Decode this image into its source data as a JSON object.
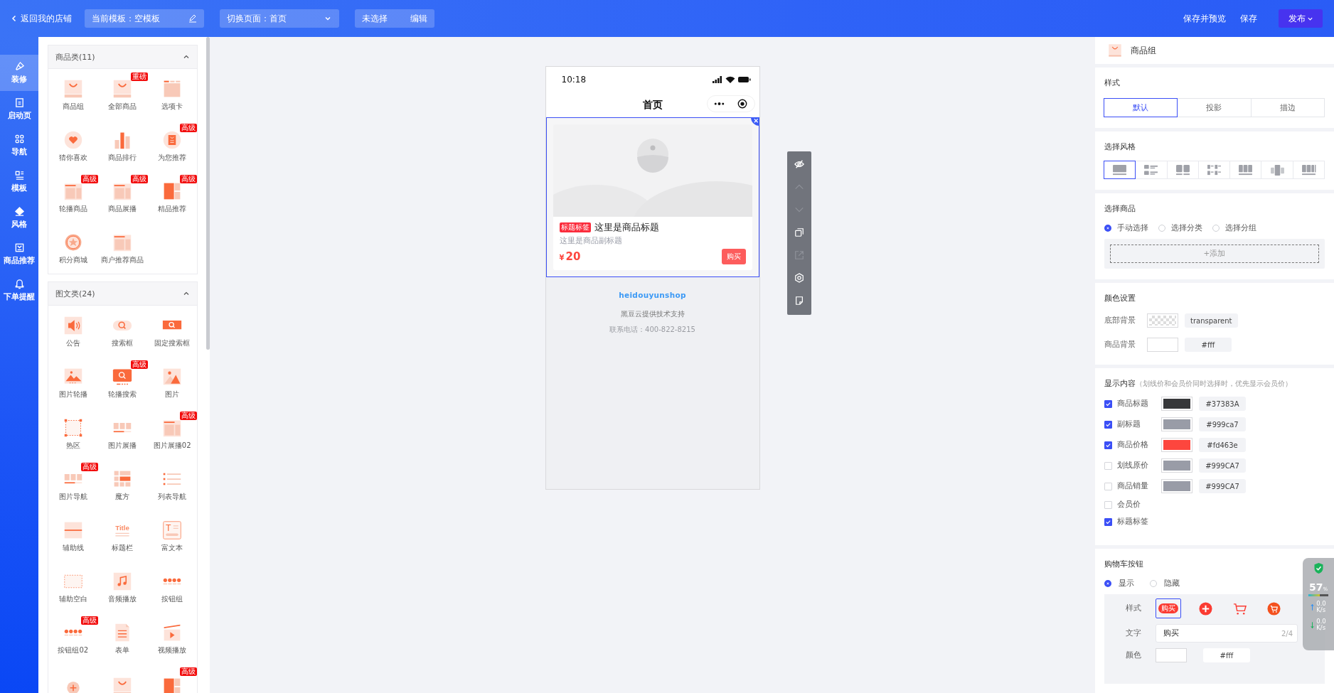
{
  "topbar": {
    "back": "返回我的店铺",
    "template": "当前模板：空模板",
    "page_switch": "切换页面：首页",
    "selection": "未选择",
    "edit": "编辑",
    "actions": [
      "保存并预览",
      "保存"
    ],
    "publish": "发布"
  },
  "rail": [
    {
      "label": "装修",
      "selected": true
    },
    {
      "label": "启动页",
      "selected": false
    },
    {
      "label": "导航",
      "selected": false
    },
    {
      "label": "模板",
      "selected": false
    },
    {
      "label": "风格",
      "selected": false
    },
    {
      "label": "商品推荐",
      "selected": false
    },
    {
      "label": "下单提醒",
      "selected": false
    }
  ],
  "component_groups": [
    {
      "title": "商品类(11)",
      "expanded": true,
      "items": [
        {
          "label": "商品组"
        },
        {
          "label": "全部商品",
          "badge": "重磅"
        },
        {
          "label": "选项卡"
        },
        {
          "label": "猜你喜欢"
        },
        {
          "label": "商品排行"
        },
        {
          "label": "为您推荐",
          "badge": "高级"
        },
        {
          "label": "轮播商品",
          "badge": "高级"
        },
        {
          "label": "商品展播",
          "badge": "高级"
        },
        {
          "label": "精品推荐",
          "badge": "高级"
        },
        {
          "label": "积分商城"
        },
        {
          "label": "商户推荐商品"
        }
      ]
    },
    {
      "title": "图文类(24)",
      "expanded": true,
      "items": [
        {
          "label": "公告"
        },
        {
          "label": "搜索框"
        },
        {
          "label": "固定搜索框"
        },
        {
          "label": "图片轮播"
        },
        {
          "label": "轮播搜索",
          "badge": "高级"
        },
        {
          "label": "图片"
        },
        {
          "label": "热区"
        },
        {
          "label": "图片展播"
        },
        {
          "label": "图片展播02",
          "badge": "高级"
        },
        {
          "label": "图片导航",
          "badge": "高级"
        },
        {
          "label": "魔方"
        },
        {
          "label": "列表导航"
        },
        {
          "label": "辅助线"
        },
        {
          "label": "标题栏",
          "icon_text": "Title"
        },
        {
          "label": "富文本",
          "icon_text": "T"
        },
        {
          "label": "辅助空白"
        },
        {
          "label": "音频播放"
        },
        {
          "label": "按钮组"
        },
        {
          "label": "按钮组02",
          "badge": "高级"
        },
        {
          "label": "表单"
        },
        {
          "label": "视频播放"
        },
        {
          "kind": "cut"
        },
        {
          "kind": "cut"
        },
        {
          "kind": "cut",
          "badge": "高级"
        }
      ]
    }
  ],
  "phone": {
    "time": "10:18",
    "title": "首页",
    "product": {
      "tag": "标题标签",
      "title": "这里是商品标题",
      "subtitle": "这里是商品副标题",
      "currency": "¥",
      "price": "20",
      "buy": "购买"
    },
    "footer": {
      "logo": "heidouyunshop",
      "support": "黑豆云提供技术支持",
      "contact": "联系电话：400-822-8215"
    }
  },
  "tools": [
    {
      "disabled": false
    },
    {
      "disabled": true
    },
    {
      "disabled": true
    },
    {
      "disabled": false
    },
    {
      "disabled": true
    },
    {
      "disabled": false
    },
    {
      "disabled": false
    }
  ],
  "settings": {
    "title": "商品组",
    "style": {
      "label": "样式",
      "options": [
        {
          "label": "默认",
          "selected": true
        },
        {
          "label": "投影",
          "selected": false
        },
        {
          "label": "描边",
          "selected": false
        }
      ]
    },
    "layout": {
      "label": "选择风格",
      "options": [
        {
          "selected": true
        },
        {
          "selected": false
        },
        {
          "selected": false
        },
        {
          "selected": false
        },
        {
          "selected": false
        },
        {
          "selected": false
        },
        {
          "selected": false
        }
      ]
    },
    "goods": {
      "label": "选择商品",
      "options": [
        {
          "label": "手动选择",
          "selected": true
        },
        {
          "label": "选择分类",
          "selected": false
        },
        {
          "label": "选择分组",
          "selected": false
        }
      ],
      "add": "+添加"
    },
    "colors": {
      "label": "颜色设置",
      "rows": [
        {
          "label": "底部背景",
          "kind": "checker",
          "value": "transparent"
        },
        {
          "label": "商品背景",
          "kind": "solid",
          "color": "#ffffff",
          "value": "#fff"
        }
      ]
    },
    "display": {
      "label": "显示内容",
      "hint": "（划线价和会员价同时选择时，优先显示会员价）",
      "rows": [
        {
          "label": "商品标题",
          "checked": true,
          "color": "#37383a",
          "value": "#37383A"
        },
        {
          "label": "副标题",
          "checked": true,
          "color": "#999ca7",
          "value": "#999ca7"
        },
        {
          "label": "商品价格",
          "checked": true,
          "color": "#fd463e",
          "value": "#fd463e"
        },
        {
          "label": "划线原价",
          "checked": false,
          "color": "#999ca7",
          "value": "#999CA7"
        },
        {
          "label": "商品销量",
          "checked": false,
          "color": "#999ca7",
          "value": "#999CA7"
        },
        {
          "label": "会员价",
          "checked": false
        },
        {
          "label": "标题标签",
          "checked": true
        }
      ]
    },
    "cart": {
      "label": "购物车按钮",
      "visibility": [
        {
          "label": "显示",
          "selected": true
        },
        {
          "label": "隐藏",
          "selected": false
        }
      ],
      "style_label": "样式",
      "styles": [
        {
          "selected": true,
          "text": "购买"
        },
        {
          "selected": false
        },
        {
          "selected": false
        },
        {
          "selected": false
        }
      ],
      "text_label": "文字",
      "text_value": "购买",
      "text_count": "2/4",
      "color_label": "颜色",
      "color": "#ffffff",
      "color_value": "#fff"
    }
  },
  "monitor": {
    "percent": "57",
    "unit": "%",
    "level": 0.57,
    "rates": [
      {
        "value": "0.0",
        "unit": "K/s"
      },
      {
        "value": "0.0",
        "unit": "K/s"
      }
    ]
  }
}
